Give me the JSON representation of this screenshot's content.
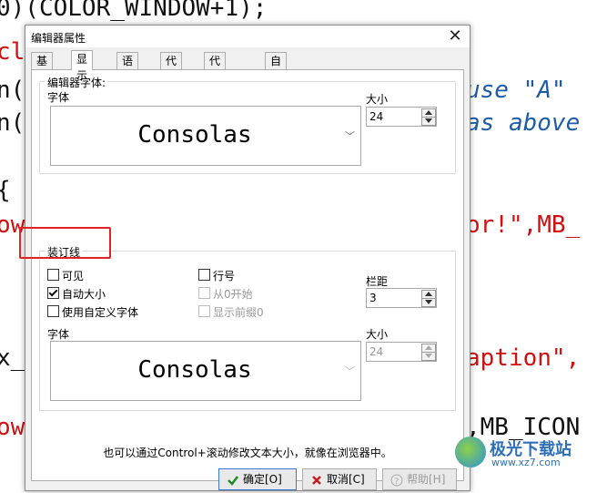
{
  "background_code": {
    "lines": [
      {
        "text": "0)(COLOR_WINDOW+1);",
        "cls": "kw-black"
      },
      {
        "text": "cl",
        "cls": "kw-red"
      },
      {
        "text": "n(",
        "cls": "kw-black"
      },
      {
        "text": "use \"A\"",
        "cls": "kw-blue"
      },
      {
        "text": "n(",
        "cls": "kw-black"
      },
      {
        "text": "as above",
        "cls": "kw-blue"
      },
      {
        "text": "{",
        "cls": "kw-black"
      },
      {
        "text": "ow",
        "cls": "kw-red"
      },
      {
        "text": "or!\",MB_",
        "cls": "kw-red"
      },
      {
        "text": "x_c",
        "cls": "kw-black"
      },
      {
        "text": "aption\",",
        "cls": "kw-red"
      },
      {
        "text": "ow",
        "cls": "kw-red"
      },
      {
        "text": ",MB_ICON",
        "cls": "kw-black"
      }
    ]
  },
  "dialog": {
    "title": "编辑器属性",
    "close_symbol": "✕",
    "tabs": [
      {
        "label": "基本",
        "active": false
      },
      {
        "label": "显示",
        "active": true
      },
      {
        "label": "语法",
        "active": false
      },
      {
        "label": "代码",
        "active": false
      },
      {
        "label": "代码补全",
        "active": false
      },
      {
        "label": "自动保存",
        "active": false
      }
    ],
    "editor_font": {
      "group_title": "编辑器字体:",
      "font_label": "字体",
      "font_value": "Consolas",
      "size_label": "大小",
      "size_value": "24"
    },
    "gutter": {
      "group_title": "装订线",
      "visible": {
        "label": "可见",
        "checked": false
      },
      "auto_size": {
        "label": "自动大小",
        "checked": true
      },
      "custom_font": {
        "label": "使用自定义字体",
        "checked": false
      },
      "line_numbers": {
        "label": "行号",
        "checked": false
      },
      "start_at_zero": {
        "label": "从0开始",
        "checked": false,
        "disabled": true
      },
      "show_leading_zeros": {
        "label": "显示前缀0",
        "checked": false,
        "disabled": true
      },
      "margin_label": "栏距",
      "margin_value": "3",
      "font_label": "字体",
      "font_value": "Consolas",
      "size_label": "大小",
      "size_value": "24"
    },
    "hint": "也可以通过Control+滚动修改文本大小，就像在浏览器中。",
    "buttons": {
      "ok": "确定[O]",
      "cancel": "取消[C]",
      "help": "帮助[H]"
    }
  },
  "watermark": {
    "name": "极光下载站",
    "url": "www.xz7.com"
  },
  "colors": {
    "highlight": "#e02222",
    "keyword_red": "#d01010",
    "string_blue": "#1d5aa8"
  }
}
